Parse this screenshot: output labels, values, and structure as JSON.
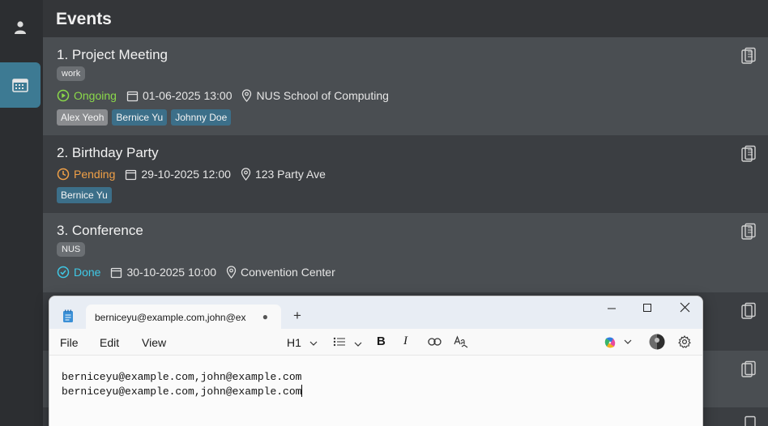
{
  "sidebar": {
    "items": [
      {
        "icon": "user-icon"
      },
      {
        "icon": "calendar-icon",
        "active": true
      }
    ]
  },
  "header": {
    "title": "Events"
  },
  "events": [
    {
      "title": "1. Project Meeting",
      "tags": [
        "work"
      ],
      "status": "Ongoing",
      "status_color": "#8bd94a",
      "datetime": "01-06-2025 13:00",
      "location": "NUS School of Computing",
      "people": [
        "Alex Yeoh",
        "Bernice Yu",
        "Johnny Doe"
      ]
    },
    {
      "title": "2. Birthday Party",
      "tags": [],
      "status": "Pending",
      "status_color": "#f0a047",
      "datetime": "29-10-2025 12:00",
      "location": "123 Party Ave",
      "people": [
        "Bernice Yu"
      ]
    },
    {
      "title": "3. Conference",
      "tags": [
        "NUS"
      ],
      "status": "Done",
      "status_color": "#3fc9e6",
      "datetime": "30-10-2025 10:00",
      "location": "Convention Center",
      "people": []
    }
  ],
  "notepad": {
    "tab_title": "berniceyu@example.com,john@ex",
    "add_tab": "+",
    "menus": [
      "File",
      "Edit",
      "View"
    ],
    "heading_select": "H1",
    "lines": [
      "berniceyu@example.com,john@example.com",
      "berniceyu@example.com,john@example.com"
    ]
  }
}
